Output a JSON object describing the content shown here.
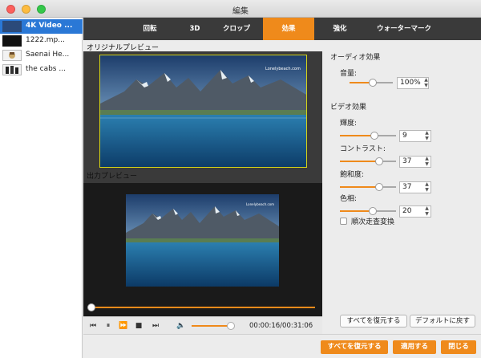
{
  "window": {
    "title": "編集"
  },
  "files": [
    {
      "name": "4K Video ...",
      "selected": true
    },
    {
      "name": "1222.mp..."
    },
    {
      "name": "Saenai He..."
    },
    {
      "name": "the cabs ..."
    }
  ],
  "tabs": [
    {
      "label": "回転"
    },
    {
      "label": "3D"
    },
    {
      "label": "クロップ"
    },
    {
      "label": "効果",
      "active": true
    },
    {
      "label": "強化"
    },
    {
      "label": "ウォーターマーク"
    }
  ],
  "preview": {
    "original_label": "オリジナルプレビュー",
    "output_label": "出力プレビュー",
    "watermark_text": "Lonelybeach.com"
  },
  "player": {
    "progress": 0.0,
    "volume": 0.9,
    "time": "00:00:16/00:31:06"
  },
  "effects": {
    "audio_title": "オーディオ効果",
    "volume_label": "音量:",
    "volume_value": "100%",
    "video_title": "ビデオ効果",
    "brightness_label": "輝度:",
    "brightness_value": "9",
    "contrast_label": "コントラスト:",
    "contrast_value": "37",
    "saturation_label": "飽和度:",
    "saturation_value": "37",
    "hue_label": "色相:",
    "hue_value": "20",
    "deinterlace_label": "順次走査変換",
    "deinterlace_checked": false,
    "reset_all_label": "すべてを復元する",
    "default_label": "デフォルトに戻す"
  },
  "footer": {
    "restore_all_label": "すべてを復元する",
    "apply_label": "適用する",
    "close_label": "閉じる"
  },
  "colors": {
    "accent": "#ef8a1b",
    "selection": "#2a78d6",
    "tabbar": "#3a3a3a"
  }
}
